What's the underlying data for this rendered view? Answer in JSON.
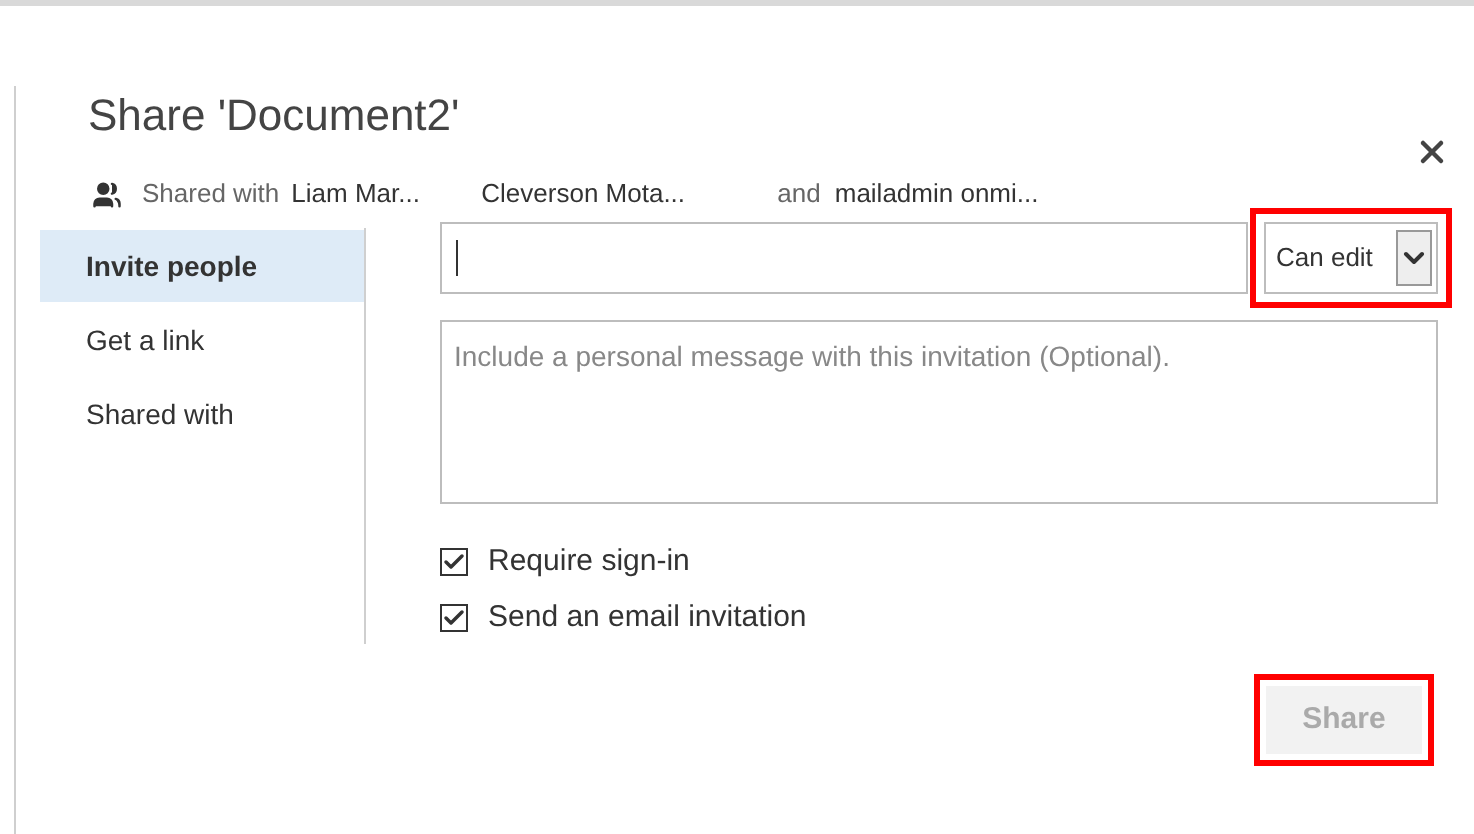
{
  "dialog": {
    "title": "Share 'Document2'",
    "shared_with": {
      "label": "Shared with",
      "people": [
        "Liam Mar...",
        "Cleverson Mota...",
        "mailadmin onmi..."
      ],
      "conjunction": "and"
    },
    "nav": [
      {
        "label": "Invite people",
        "selected": true
      },
      {
        "label": "Get a link",
        "selected": false
      },
      {
        "label": "Shared with",
        "selected": false
      }
    ],
    "permission": {
      "value": "Can edit",
      "highlighted": true
    },
    "message": {
      "placeholder": "Include a personal message with this invitation (Optional)."
    },
    "options": [
      {
        "label": "Require sign-in",
        "checked": true
      },
      {
        "label": "Send an email invitation",
        "checked": true
      }
    ],
    "share_button": {
      "label": "Share",
      "disabled": true,
      "highlighted": true
    }
  }
}
